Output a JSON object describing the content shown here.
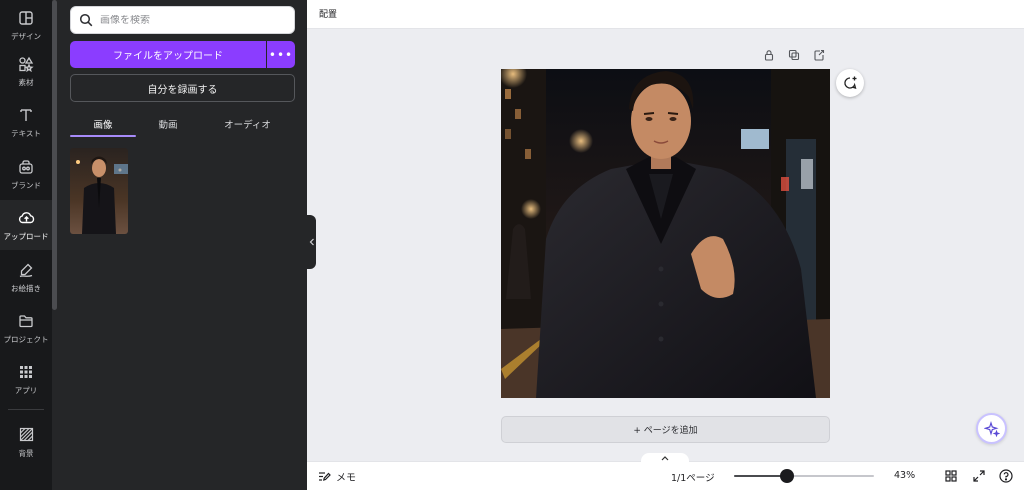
{
  "rail": {
    "items": [
      {
        "label": "デザイン",
        "icon": "design-icon"
      },
      {
        "label": "素材",
        "icon": "elements-icon"
      },
      {
        "label": "テキスト",
        "icon": "text-icon"
      },
      {
        "label": "ブランド",
        "icon": "brand-icon"
      },
      {
        "label": "アップロード",
        "icon": "upload-cloud-icon"
      },
      {
        "label": "お絵描き",
        "icon": "draw-icon"
      },
      {
        "label": "プロジェクト",
        "icon": "folder-icon"
      },
      {
        "label": "アプリ",
        "icon": "apps-grid-icon"
      },
      {
        "label": "背景",
        "icon": "background-icon"
      }
    ]
  },
  "panel": {
    "search_placeholder": "画像を検索",
    "upload_label": "ファイルをアップロード",
    "more_label": "•••",
    "record_label": "自分を録画する",
    "tabs": [
      {
        "label": "画像"
      },
      {
        "label": "動画"
      },
      {
        "label": "オーディオ"
      }
    ]
  },
  "topbar": {
    "arrange_label": "配置"
  },
  "canvas": {
    "add_page_label": "+ ページを追加"
  },
  "bottombar": {
    "memo_label": "メモ",
    "page_indicator": "1/1ページ",
    "zoom_level": "43%",
    "zoom_fraction": 0.38
  },
  "colors": {
    "accent": "#8b3dff",
    "rail_bg": "#18191b",
    "panel_bg": "#252628",
    "workspace_bg": "#ecedf1"
  }
}
